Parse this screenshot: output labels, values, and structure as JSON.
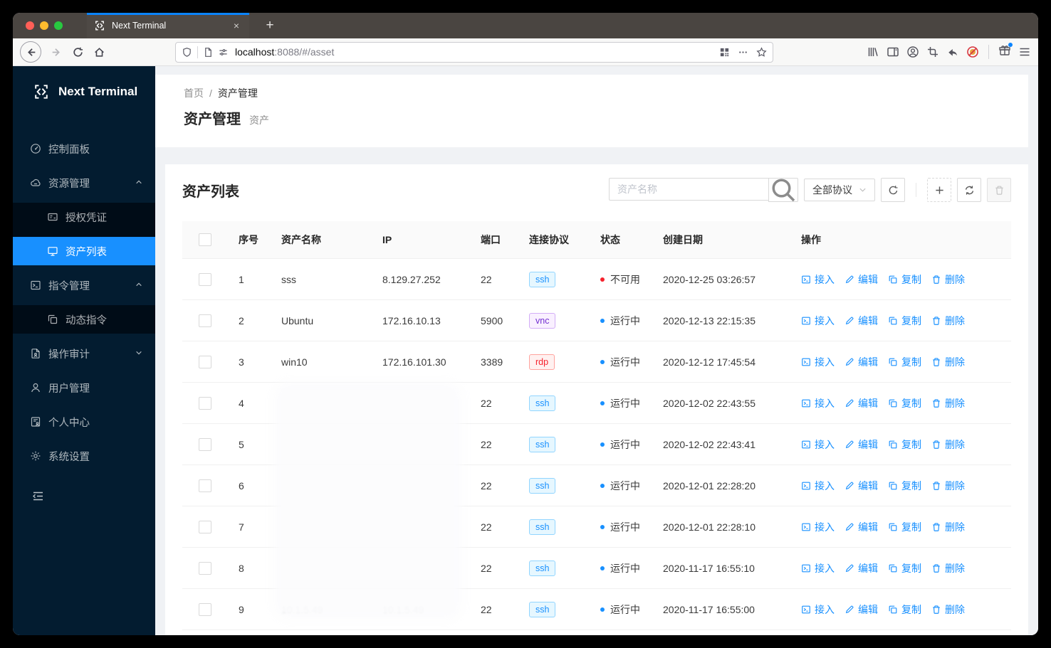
{
  "browser": {
    "window_controls": [
      "close",
      "minimize",
      "zoom"
    ],
    "tab": {
      "title": "Next Terminal",
      "close_glyph": "×"
    },
    "new_tab_glyph": "+",
    "url": {
      "host": "localhost",
      "path": ":8088/#/asset"
    },
    "urlbar_icons": [
      "shield-icon",
      "page-info-icon",
      "permissions-icon",
      "qr-code-icon",
      "page-actions-icon",
      "bookmark-star-icon"
    ],
    "toolbar_icons": [
      "back-icon",
      "forward-icon",
      "reload-icon",
      "home-icon",
      "library-icon",
      "sidebar-toggle-icon",
      "account-icon",
      "screenshot-icon",
      "send-tab-icon",
      "blocked-content-icon",
      "gift-icon",
      "menu-icon"
    ]
  },
  "sidebar": {
    "logo_text": "Next Terminal",
    "items": [
      {
        "label": "控制面板",
        "icon": "dashboard-icon"
      },
      {
        "label": "资源管理",
        "icon": "cloud-icon",
        "expanded": true
      },
      {
        "label": "授权凭证",
        "icon": "credential-icon",
        "submenu": true
      },
      {
        "label": "资产列表",
        "icon": "desktop-icon",
        "submenu": true,
        "selected": true
      },
      {
        "label": "指令管理",
        "icon": "command-icon",
        "expanded": true
      },
      {
        "label": "动态指令",
        "icon": "dynamic-command-icon",
        "submenu": true
      },
      {
        "label": "操作审计",
        "icon": "audit-icon",
        "collapsed": true
      },
      {
        "label": "用户管理",
        "icon": "user-icon"
      },
      {
        "label": "个人中心",
        "icon": "profile-icon"
      },
      {
        "label": "系统设置",
        "icon": "settings-icon"
      }
    ]
  },
  "header": {
    "breadcrumb": [
      "首页",
      "资产管理"
    ],
    "separator": "/",
    "title": "资产管理",
    "subtitle": "资产"
  },
  "card": {
    "title": "资产列表",
    "search_placeholder": "资产名称",
    "protocol_filter_value": "全部协议"
  },
  "table": {
    "columns": [
      "序号",
      "资产名称",
      "IP",
      "端口",
      "连接协议",
      "状态",
      "创建日期",
      "操作"
    ],
    "actions": [
      {
        "label": "接入",
        "icon": "terminal-icon"
      },
      {
        "label": "编辑",
        "icon": "edit-icon"
      },
      {
        "label": "复制",
        "icon": "copy-icon"
      },
      {
        "label": "删除",
        "icon": "delete-icon"
      }
    ],
    "status_colors": {
      "运行中": "#1890ff",
      "不可用": "#f5222d"
    },
    "protocol_colors": {
      "ssh": {
        "text": "#1890ff",
        "bg": "#e6f7ff",
        "border": "#91d5ff"
      },
      "vnc": {
        "text": "#722ed1",
        "bg": "#f9f0ff",
        "border": "#d3adf7"
      },
      "rdp": {
        "text": "#f5222d",
        "bg": "#fff1f0",
        "border": "#ffa39e"
      }
    },
    "rows": [
      {
        "no": "1",
        "name": "sss",
        "ip": "8.129.27.252",
        "port": "22",
        "protocol": "ssh",
        "status": "不可用",
        "created": "2020-12-25 03:26:57",
        "masked": false
      },
      {
        "no": "2",
        "name": "Ubuntu",
        "ip": "172.16.10.13",
        "port": "5900",
        "protocol": "vnc",
        "status": "运行中",
        "created": "2020-12-13 22:15:35",
        "masked": false
      },
      {
        "no": "3",
        "name": "win10",
        "ip": "172.16.101.30",
        "port": "3389",
        "protocol": "rdp",
        "status": "运行中",
        "created": "2020-12-12 17:45:54",
        "masked": false
      },
      {
        "no": "4",
        "name": "",
        "ip": "",
        "port": "22",
        "protocol": "ssh",
        "status": "运行中",
        "created": "2020-12-02 22:43:55",
        "masked": true
      },
      {
        "no": "5",
        "name": "",
        "ip": "",
        "port": "22",
        "protocol": "ssh",
        "status": "运行中",
        "created": "2020-12-02 22:43:41",
        "masked": true
      },
      {
        "no": "6",
        "name": "",
        "ip": "",
        "port": "22",
        "protocol": "ssh",
        "status": "运行中",
        "created": "2020-12-01 22:28:20",
        "masked": true
      },
      {
        "no": "7",
        "name": "",
        "ip": "",
        "port": "22",
        "protocol": "ssh",
        "status": "运行中",
        "created": "2020-12-01 22:28:10",
        "masked": true
      },
      {
        "no": "8",
        "name": "",
        "ip": "",
        "port": "22",
        "protocol": "ssh",
        "status": "运行中",
        "created": "2020-11-17 16:55:10",
        "masked": true
      },
      {
        "no": "9",
        "name": "10.1.5.49",
        "ip": "10.1.5.49",
        "port": "22",
        "protocol": "ssh",
        "status": "运行中",
        "created": "2020-11-17 16:55:00",
        "masked": true
      }
    ]
  },
  "colors": {
    "accent": "#1890ff",
    "sidebar_bg": "#031c30",
    "sidebar_submenu_bg": "#000c17",
    "selected_menu_bg": "#1890ff",
    "page_bg": "#f0f2f5",
    "tab_stripe": "#0a84ff",
    "status_unavailable_dot": "#f5222d",
    "status_running_dot": "#1890ff"
  }
}
